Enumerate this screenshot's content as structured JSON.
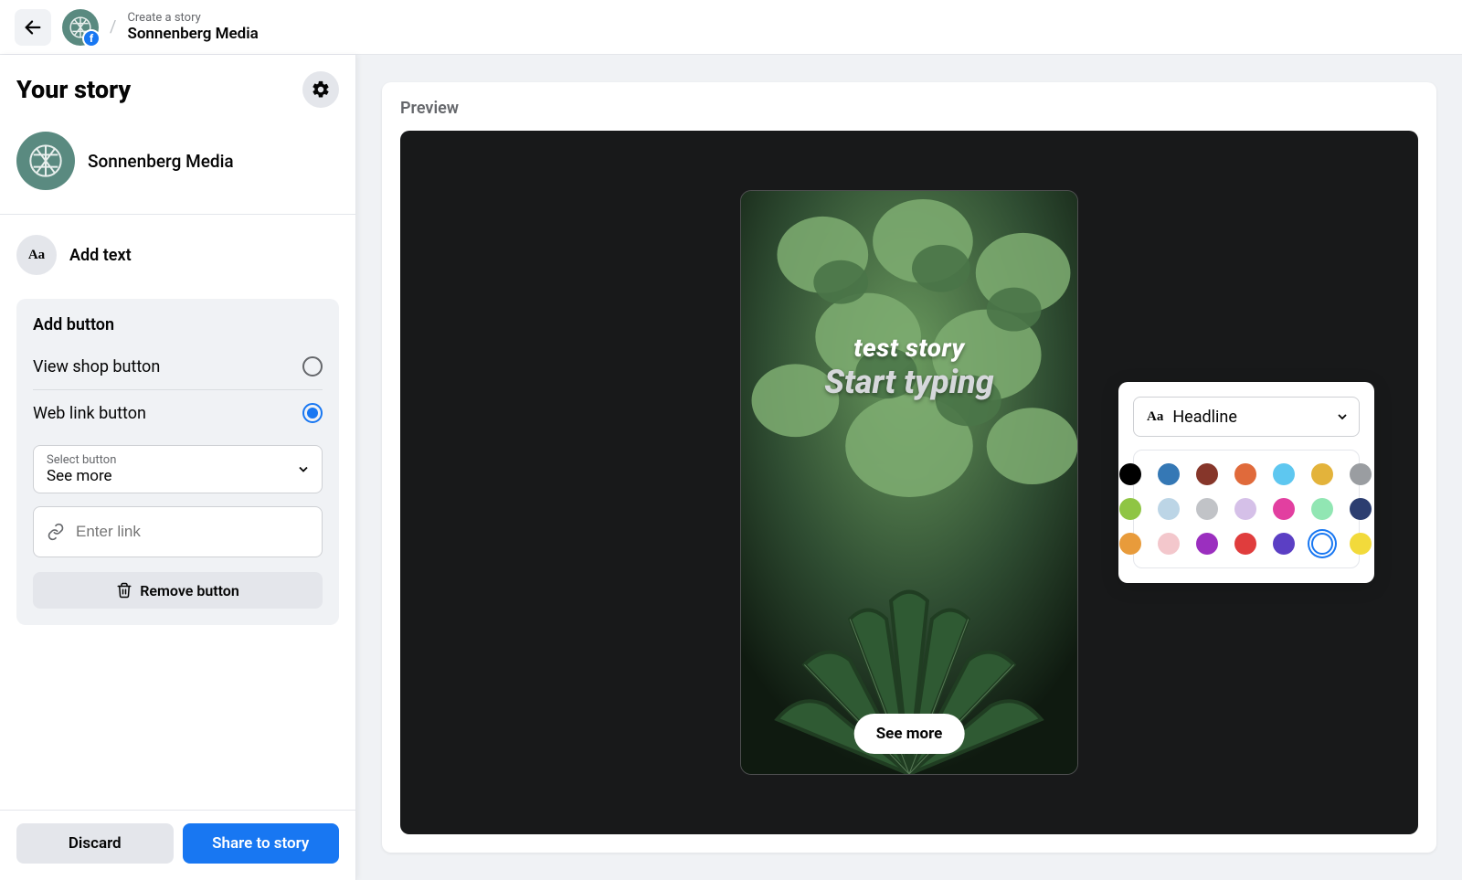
{
  "topbar": {
    "crumb_top": "Create a story",
    "crumb_bottom": "Sonnenberg Media"
  },
  "sidebar": {
    "title": "Your story",
    "page_name": "Sonnenberg Media",
    "add_text_label": "Add text",
    "add_button": {
      "title": "Add button",
      "option_shop": "View shop button",
      "option_web": "Web link button",
      "selected": "web",
      "select_button_label": "Select button",
      "select_button_value": "See more",
      "link_placeholder": "Enter link",
      "remove_label": "Remove button"
    },
    "discard_label": "Discard",
    "share_label": "Share to story"
  },
  "preview": {
    "title": "Preview",
    "story_line1": "test story",
    "story_line2": "Start typing",
    "cta_label": "See more"
  },
  "text_panel": {
    "font_label": "Headline",
    "aa_glyph": "Aa",
    "colors_row1": [
      "#000000",
      "#3578b5",
      "#86362a",
      "#e06a3b",
      "#5ec7f0",
      "#e3b33b",
      "#9a9da1"
    ],
    "colors_row2": [
      "#8fc544",
      "#bcd5e6",
      "#c1c3c7",
      "#d5c0e8",
      "#e23fa0",
      "#91e6b3",
      "#2c3e70"
    ],
    "colors_row3": [
      "#e89b3b",
      "#f3c7cc",
      "#9b2fbf",
      "#e03d3d",
      "#5b3fc4",
      "ring",
      "#f2da3b"
    ]
  }
}
